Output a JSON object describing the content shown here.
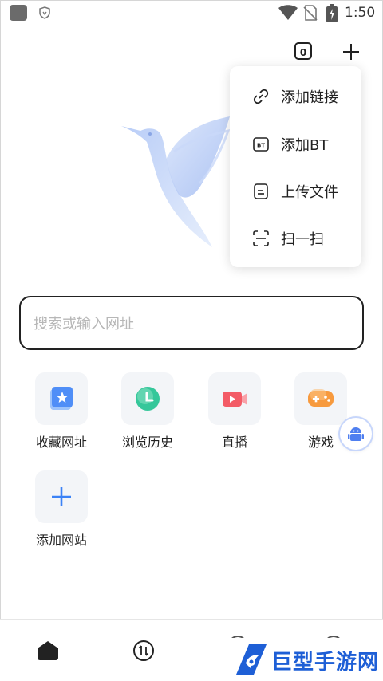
{
  "status_bar": {
    "time": "1:50"
  },
  "top_bar": {
    "tab_count": "0"
  },
  "menu": {
    "items": [
      {
        "label": "添加链接",
        "icon": "link-icon"
      },
      {
        "label": "添加BT",
        "icon": "bt-icon"
      },
      {
        "label": "上传文件",
        "icon": "file-icon"
      },
      {
        "label": "扫一扫",
        "icon": "scan-icon"
      }
    ]
  },
  "search": {
    "placeholder": "搜索或输入网址"
  },
  "shortcuts": [
    {
      "label": "收藏网址",
      "icon": "star-bookmark-icon",
      "color": "#4f8ef7"
    },
    {
      "label": "浏览历史",
      "icon": "clock-icon",
      "color": "#35c79a"
    },
    {
      "label": "直播",
      "icon": "video-icon",
      "color": "#f35b66"
    },
    {
      "label": "游戏",
      "icon": "gamepad-icon",
      "color": "#f79a3e"
    },
    {
      "label": "添加网站",
      "icon": "plus-icon",
      "color": "#3b82f6"
    }
  ],
  "watermark": {
    "text": "巨型手游网"
  },
  "colors": {
    "accent": "#3b82f6",
    "menu_bg": "#ffffff",
    "tile_bg": "#f3f5f8"
  }
}
